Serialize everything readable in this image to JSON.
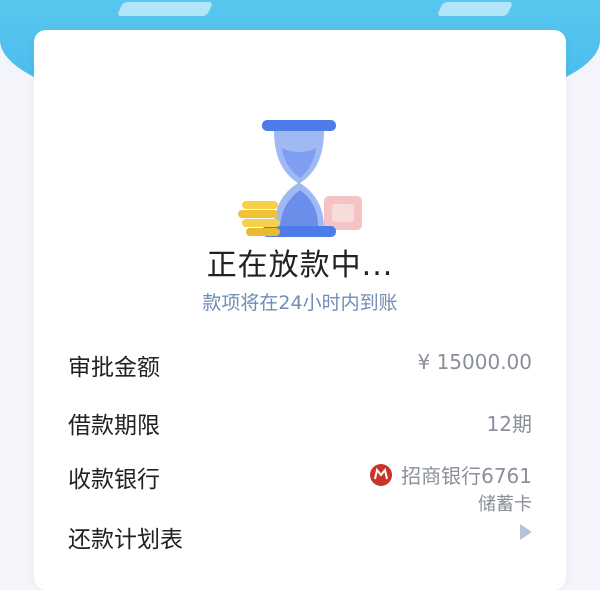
{
  "status": {
    "title": "正在放款中...",
    "subtitle": "款项将在24小时内到账"
  },
  "details": {
    "amount_label": "审批金额",
    "amount_value": "¥ 15000.00",
    "term_label": "借款期限",
    "term_value": "12期",
    "bank_label": "收款银行",
    "bank_name": "招商银行6761",
    "card_type": "储蓄卡",
    "plan_label": "还款计划表"
  },
  "colors": {
    "header": "#4cbdee",
    "subtitle": "#6f8db5",
    "hourglass": "#4d7be8",
    "bank_logo": "#c8342a"
  },
  "icons": {
    "illustration": "hourglass-coins-icon",
    "bank_logo": "cmb-bank-logo-icon",
    "plan_arrow": "chevron-right-icon"
  }
}
